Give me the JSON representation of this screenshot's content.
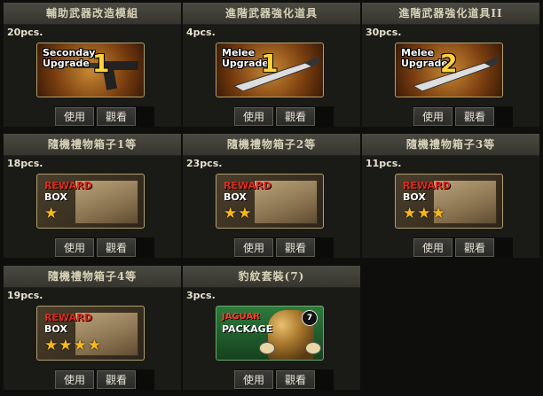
{
  "buttons": {
    "use": "使用",
    "view": "觀看"
  },
  "cards": [
    {
      "title": "輔助武器改造模組",
      "qty": "20pcs.",
      "image": {
        "type": "upgrade",
        "line1": "Seconday",
        "line2": "Upgrade",
        "num": "1"
      }
    },
    {
      "title": "進階武器強化道具",
      "qty": "4pcs.",
      "image": {
        "type": "upgrade",
        "line1": "Melee",
        "line2": "Upgrade",
        "num": "1"
      }
    },
    {
      "title": "進階武器強化道具II",
      "qty": "30pcs.",
      "image": {
        "type": "upgrade",
        "line1": "Melee",
        "line2": "Upgrade",
        "num": "2"
      }
    },
    {
      "title": "隨機禮物箱子1等",
      "qty": "18pcs.",
      "image": {
        "type": "reward",
        "line1": "REWARD",
        "line2": "BOX",
        "stars": "★"
      }
    },
    {
      "title": "隨機禮物箱子2等",
      "qty": "23pcs.",
      "image": {
        "type": "reward",
        "line1": "REWARD",
        "line2": "BOX",
        "stars": "★★"
      }
    },
    {
      "title": "隨機禮物箱子3等",
      "qty": "11pcs.",
      "image": {
        "type": "reward",
        "line1": "REWARD",
        "line2": "BOX",
        "stars": "★★★"
      }
    },
    {
      "title": "隨機禮物箱子4等",
      "qty": "19pcs.",
      "image": {
        "type": "reward",
        "line1": "REWARD",
        "line2": "BOX",
        "stars": "★★★★"
      }
    },
    {
      "title": "豹紋套裝(7)",
      "qty": "3pcs.",
      "image": {
        "type": "jaguar",
        "line1": "JAGUAR",
        "line2": "PACKAGE",
        "badge": "7"
      }
    }
  ],
  "colors": {
    "title_bar": "#3f3f37",
    "card_bg": "#1a1a17",
    "star": "#f6b81c",
    "reward_red": "#e02a1c"
  }
}
